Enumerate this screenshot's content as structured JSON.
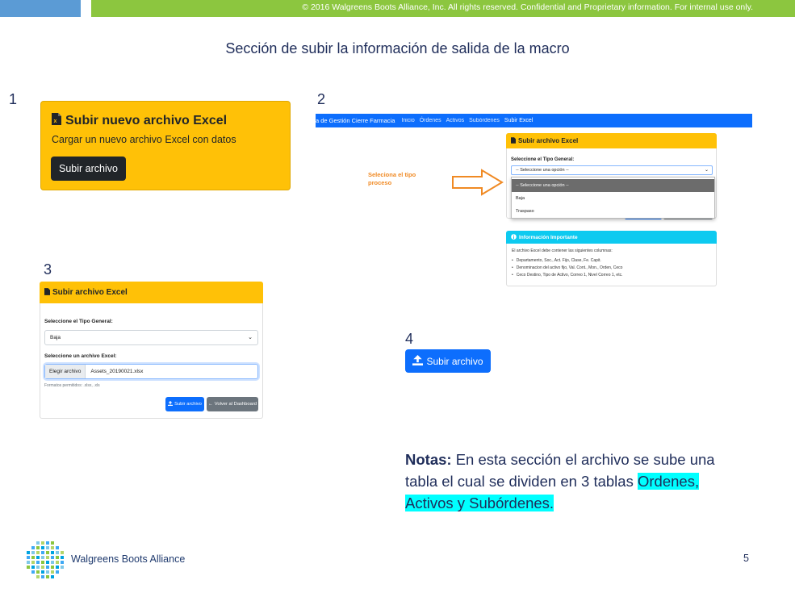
{
  "header": {
    "copyright": "© 2016 Walgreens Boots Alliance, Inc. All rights reserved. Confidential and Proprietary information. For internal use only."
  },
  "slide": {
    "title": "Sección de subir la información de salida de la macro",
    "page_number": "5"
  },
  "steps": [
    "1",
    "2",
    "3",
    "4"
  ],
  "panel1": {
    "title": "Subir nuevo archivo Excel",
    "subtitle": "Cargar un nuevo archivo Excel con datos",
    "button": "Subir archivo"
  },
  "panel2": {
    "nav": {
      "brand": "a de Gestión Cierre Farmacia",
      "links": [
        "Inicio",
        "Órdenes",
        "Activos",
        "Subórdenes",
        "Subir Excel"
      ]
    },
    "card_title": "Subir archivo Excel",
    "label": "Seleccione el Tipo General:",
    "select_value": "-- Seleccione una opción --",
    "options": [
      "-- Seleccione una opción --",
      "Baja",
      "Traspaso"
    ],
    "annotation": [
      "Seleciona el tipo",
      "proceso"
    ],
    "info": {
      "title": "Información Importante",
      "text": "El archivo Excel debe contener las siguientes columnas:",
      "items": [
        "Departamento, Soc., Act. Fijo, Clase, Fe. Capit.",
        "Denominacion del activo fijo, Val. Cont., Mon., Orden, Ceco",
        "Ceco Destino, Tipo de Activo, Correo 1, Nivel Correo 1, etc."
      ]
    }
  },
  "panel3": {
    "title": "Subir archivo Excel",
    "label_type": "Seleccione el Tipo General:",
    "select_value": "Baja",
    "label_file": "Seleccione un archivo Excel:",
    "choose_button": "Elegir archivo",
    "file_name": "Assets_20190021.xlsx",
    "hint": "Formatos permitidos: .xlsx, .xls",
    "upload_button": "Subir archivo",
    "back_button": "Volver al Dashboard"
  },
  "panel4": {
    "button": "Subir archivo"
  },
  "notes": {
    "label": "Notas:",
    "text": " En esta sección el archivo se sube  una tabla el cual se dividen en 3 tablas ",
    "highlight": "Ordenes, Activos y Subórdenes."
  },
  "footer": {
    "logo_text": "Walgreens Boots Alliance"
  },
  "colors": {
    "warning": "#ffc107",
    "primary": "#0d6efd",
    "info": "#0dcaf0",
    "arrow": "#f08a24",
    "highlight": "#00ffff"
  },
  "icons": [
    "file-excel-icon",
    "upload-icon",
    "arrow-left-icon",
    "info-circle-icon",
    "chevron-down-icon",
    "arrow-right-icon"
  ]
}
